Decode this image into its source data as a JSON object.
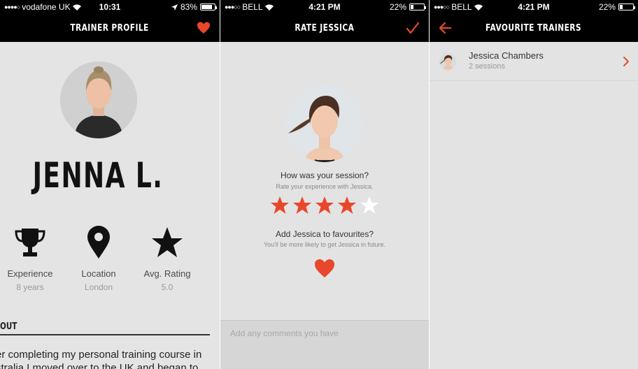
{
  "colors": {
    "accent": "#e8472b",
    "nav_bg": "#000000",
    "panel_bg": "#e4e4e4"
  },
  "screen1": {
    "status": {
      "carrier": "vodafone UK",
      "time": "10:31",
      "battery": "83%",
      "battery_level": 0.83
    },
    "nav": {
      "title": "TRAINER PROFILE",
      "right_icon": "heart-icon"
    },
    "trainer_name": "JENNA L.",
    "stats": [
      {
        "icon": "trophy-icon",
        "label": "Experience",
        "value": "8 years"
      },
      {
        "icon": "location-pin-icon",
        "label": "Location",
        "value": "London"
      },
      {
        "icon": "star-icon",
        "label": "Avg. Rating",
        "value": "5.0"
      }
    ],
    "about_heading": "OUT",
    "about_lines": [
      "er completing my personal training course in",
      "stralia I moved over to the UK and began to"
    ]
  },
  "screen2": {
    "status": {
      "carrier": "BELL",
      "time": "4:21 PM",
      "battery": "22%",
      "battery_level": 0.22
    },
    "nav": {
      "title": "RATE JESSICA",
      "right_icon": "checkmark-icon"
    },
    "question": "How was your session?",
    "question_sub": "Rate your experience with Jessica.",
    "rating": {
      "value": 4,
      "max": 5
    },
    "favourite_question": "Add Jessica to favourites?",
    "favourite_sub": "You'll be more likely to get Jessica in future.",
    "comment_placeholder": "Add any comments you have"
  },
  "screen3": {
    "status": {
      "carrier": "BELL",
      "time": "4:21 PM",
      "battery": "22%",
      "battery_level": 0.22
    },
    "nav": {
      "title": "FAVOURITE TRAINERS",
      "left_icon": "back-arrow-icon"
    },
    "favourites": [
      {
        "name": "Jessica Chambers",
        "sessions": "2 sessions"
      }
    ]
  }
}
